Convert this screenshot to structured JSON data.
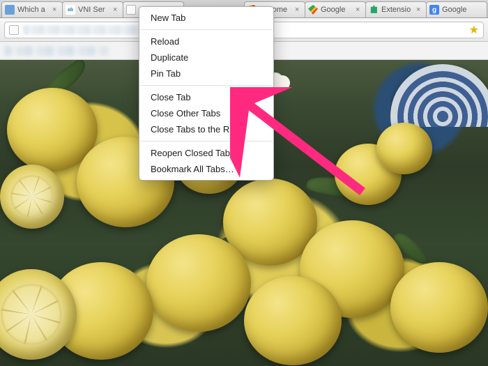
{
  "tabs": [
    {
      "title": "Which a",
      "favicon": "generic"
    },
    {
      "title": "VNI Ser",
      "favicon": "cisco"
    },
    {
      "title": "",
      "favicon": "page"
    },
    {
      "title": "",
      "favicon": "page"
    },
    {
      "title": "Chrome",
      "favicon": "chrome"
    },
    {
      "title": "Google",
      "favicon": "maps"
    },
    {
      "title": "Extensio",
      "favicon": "puzzle"
    },
    {
      "title": "Google",
      "favicon": "g"
    }
  ],
  "context_menu": {
    "groups": [
      [
        "New Tab"
      ],
      [
        "Reload",
        "Duplicate",
        "Pin Tab"
      ],
      [
        "Close Tab",
        "Close Other Tabs",
        "Close Tabs to the Right"
      ],
      [
        "Reopen Closed Tab",
        "Bookmark All Tabs…"
      ]
    ]
  },
  "annotation": {
    "arrow_target": "Close Other Tabs",
    "arrow_color": "#ff2a7f"
  },
  "star_icon": "★"
}
